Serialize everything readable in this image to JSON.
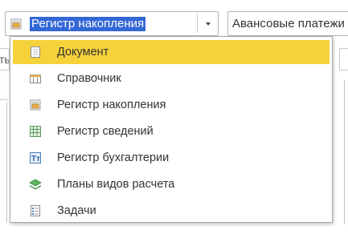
{
  "type_combo": {
    "value": "Регистр накопления",
    "icon": "accumulation-register-icon"
  },
  "right_field": {
    "value": "Авансовые платежи"
  },
  "background": {
    "left_field_fragment": "ты"
  },
  "dropdown": {
    "items": [
      {
        "label": "Документ",
        "icon": "document-icon",
        "selected": true
      },
      {
        "label": "Справочник",
        "icon": "catalog-icon",
        "selected": false
      },
      {
        "label": "Регистр накопления",
        "icon": "accumulation-register-icon",
        "selected": false
      },
      {
        "label": "Регистр сведений",
        "icon": "information-register-icon",
        "selected": false
      },
      {
        "label": "Регистр бухгалтерии",
        "icon": "accounting-register-icon",
        "selected": false
      },
      {
        "label": "Планы видов расчета",
        "icon": "calculation-types-icon",
        "selected": false
      },
      {
        "label": "Задачи",
        "icon": "tasks-icon",
        "selected": false
      }
    ]
  },
  "colors": {
    "selection_highlight": "#f5d23a",
    "text_selection": "#3367d6"
  }
}
